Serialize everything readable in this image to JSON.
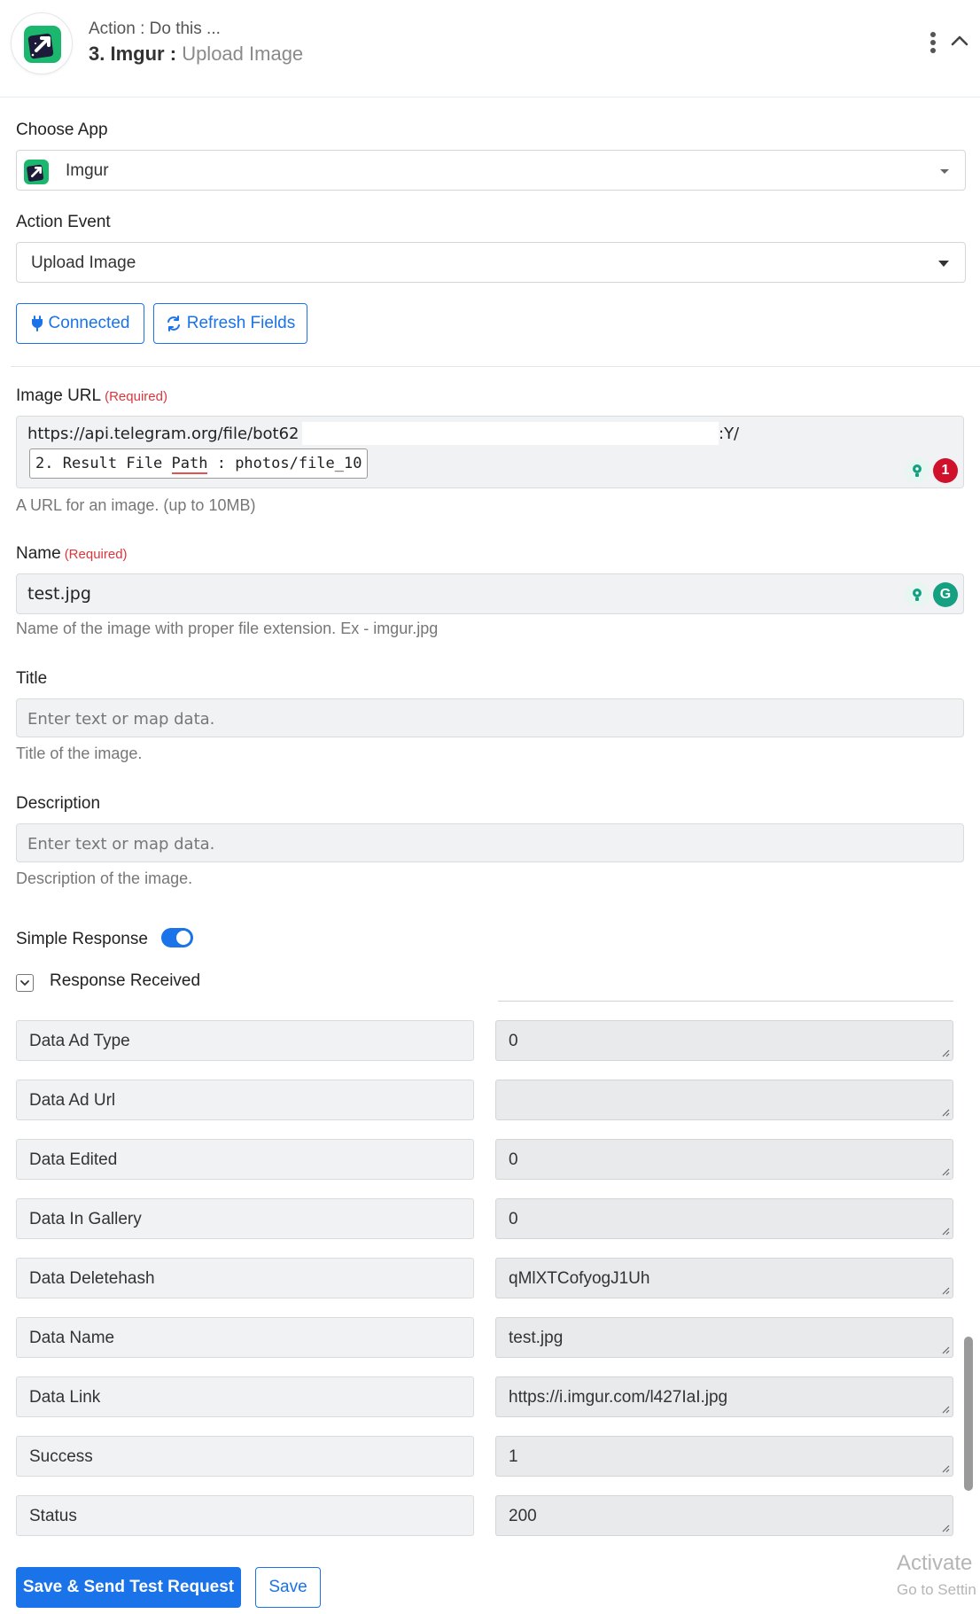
{
  "header": {
    "step_label": "Action : Do this ...",
    "step_number": "3.",
    "app_name": "Imgur",
    "separator": ":",
    "event_name": "Upload Image",
    "icons": [
      "imgur-app-icon",
      "kebab-menu-icon",
      "chevron-up-icon"
    ]
  },
  "choose_app": {
    "label": "Choose App",
    "value": "Imgur"
  },
  "action_event": {
    "label": "Action Event",
    "value": "Upload Image"
  },
  "buttons": {
    "connected": "Connected",
    "refresh": "Refresh Fields"
  },
  "image_url": {
    "label": "Image URL",
    "required": "(Required)",
    "value_start": "https://api.telegram.org/file/bot62",
    "value_end": ":Y/",
    "chip_prefix": "2. Result File ",
    "chip_underlined": "Path",
    "chip_suffix": " : photos/file_10",
    "help": "A URL for an image. (up to 10MB)",
    "badge_count": "1"
  },
  "name": {
    "label": "Name",
    "required": "(Required)",
    "value": "test.jpg",
    "help": "Name of the image with proper file extension. Ex - imgur.jpg",
    "grammarly_letter": "G"
  },
  "title": {
    "label": "Title",
    "placeholder": "Enter text or map data.",
    "help": "Title of the image."
  },
  "description": {
    "label": "Description",
    "placeholder": "Enter text or map data.",
    "help": "Description of the image."
  },
  "simple_response": {
    "label": "Simple Response",
    "enabled": true
  },
  "response_received": {
    "label": "Response Received"
  },
  "response_rows": [
    {
      "key": "Data Ad Type",
      "value": "0"
    },
    {
      "key": "Data Ad Url",
      "value": ""
    },
    {
      "key": "Data Edited",
      "value": "0"
    },
    {
      "key": "Data In Gallery",
      "value": "0"
    },
    {
      "key": "Data Deletehash",
      "value": "qMlXTCofyogJ1Uh"
    },
    {
      "key": "Data Name",
      "value": "test.jpg"
    },
    {
      "key": "Data Link",
      "value": "https://i.imgur.com/l427IaI.jpg"
    },
    {
      "key": "Success",
      "value": "1"
    },
    {
      "key": "Status",
      "value": "200"
    }
  ],
  "footer": {
    "send_test": "Save & Send Test Request",
    "save": "Save"
  },
  "watermark": {
    "line1": "Activate",
    "line2": "Go to Settin"
  },
  "colors": {
    "primary": "#1a73e8",
    "required": "#d9363e",
    "badge_red": "#d0112b",
    "grammarly_green": "#15a081"
  }
}
